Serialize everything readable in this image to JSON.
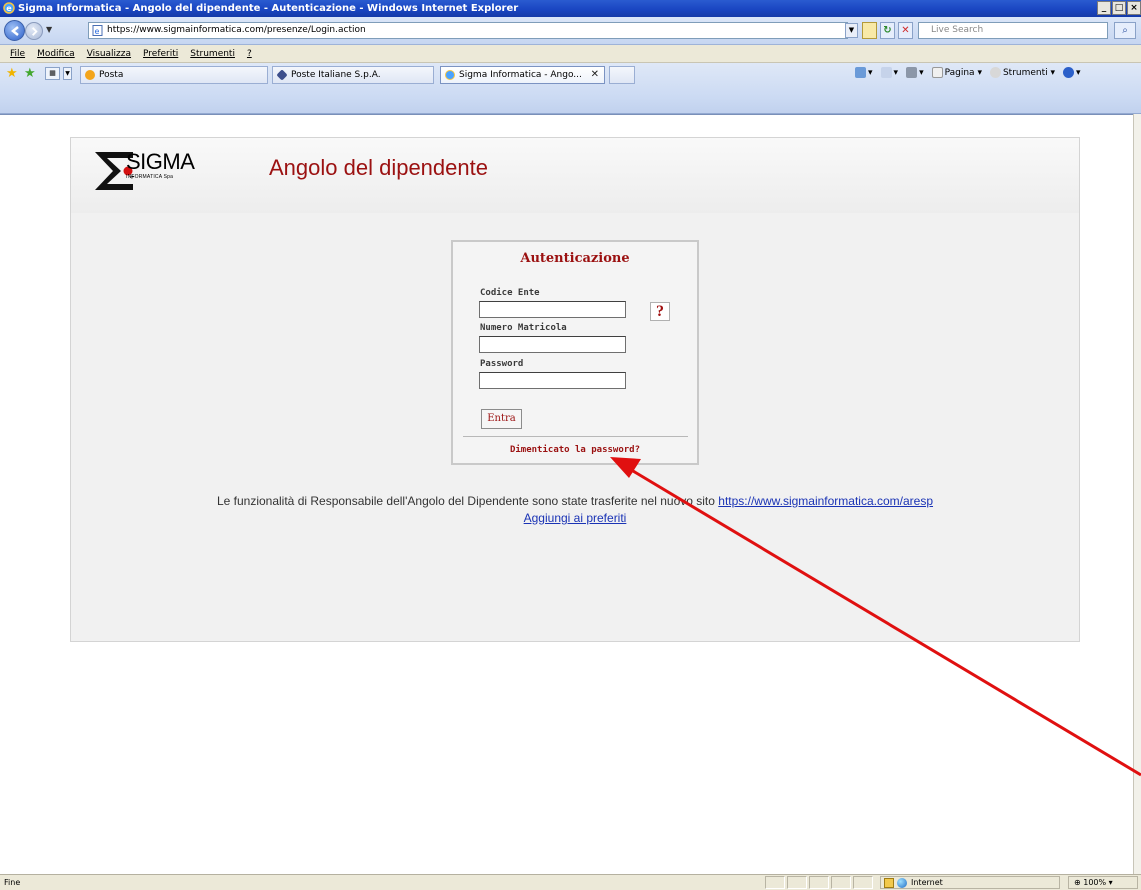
{
  "window": {
    "title": "Sigma Informatica - Angolo del dipendente - Autenticazione - Windows Internet Explorer",
    "min": "_",
    "max": "□",
    "close": "×"
  },
  "address": {
    "url": "https://www.sigmainformatica.com/presenze/Login.action",
    "search_placeholder": "Live Search"
  },
  "menu": [
    "File",
    "Modifica",
    "Visualizza",
    "Preferiti",
    "Strumenti",
    "?"
  ],
  "tabs": [
    {
      "label": "Posta"
    },
    {
      "label": "Poste Italiane S.p.A."
    },
    {
      "label": "Sigma Informatica - Ango..."
    }
  ],
  "command_bar": {
    "page": "Pagina",
    "tools": "Strumenti"
  },
  "page": {
    "logo_text": "SIGMA",
    "logo_sub": "INFORMATICA Spa",
    "title": "Angolo del dipendente",
    "login": {
      "heading": "Autenticazione",
      "codice_label": "Codice Ente",
      "matricola_label": "Numero Matricola",
      "password_label": "Password",
      "help": "?",
      "submit": "Entra",
      "forgot": "Dimenticato la password?"
    },
    "info_text": "Le funzionalità di Responsabile dell'Angolo del Dipendente sono state trasferite nel nuovo sito ",
    "info_link": "https://www.sigmainformatica.com/aresp",
    "favorites_link": "Aggiungi ai preferiti"
  },
  "status": {
    "text": "Fine",
    "zone": "Internet",
    "zoom": "100%"
  },
  "colors": {
    "brand_red": "#9b1111",
    "link_blue": "#1a33b5",
    "arrow_red": "#e01010"
  }
}
